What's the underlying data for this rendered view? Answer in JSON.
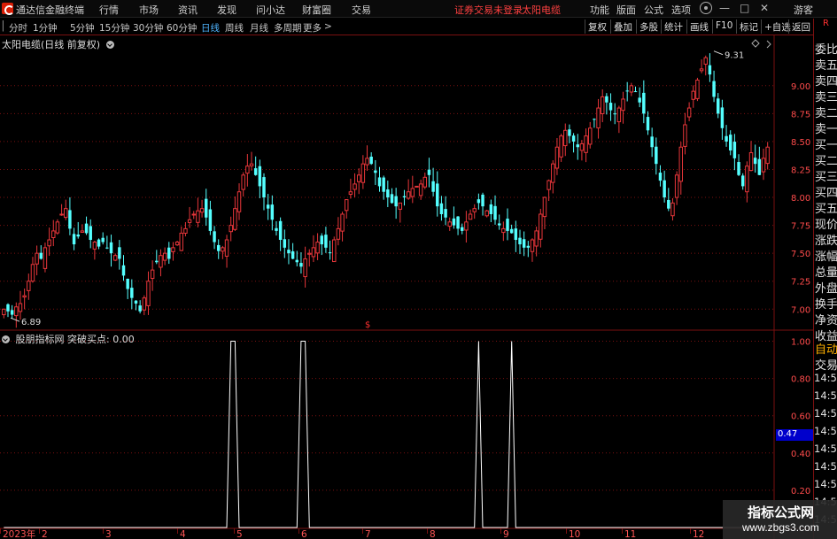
{
  "menu": {
    "app_name": "通达信金融终端",
    "items": [
      "行情",
      "市场",
      "资讯",
      "发现",
      "问小达",
      "财富圈",
      "交易"
    ],
    "notice": "证券交易未登录",
    "stock_name": "太阳电缆",
    "right_items": [
      "功能",
      "版面",
      "公式",
      "选项"
    ],
    "guest": "游客"
  },
  "periods": {
    "items": [
      "分时",
      "1分钟",
      "5分钟",
      "15分钟",
      "30分钟",
      "60分钟",
      "日线",
      "周线",
      "月线",
      "多周期",
      "更多"
    ],
    "active": "日线",
    "tools": [
      "复权",
      "叠加",
      "多股",
      "统计",
      "画线",
      "F10",
      "标记",
      "+自选",
      "返回"
    ]
  },
  "main_chart": {
    "title": "太阳电缆(日线 前复权)",
    "high_label": "9.31",
    "low_label": "6.89",
    "marker": "$"
  },
  "indicator": {
    "title": "股朋指标网 突破买点: 0.00",
    "current_value": "0.47"
  },
  "side_panel": {
    "top_label": "R",
    "labels": [
      "委比",
      "卖五",
      "卖四",
      "卖三",
      "卖二",
      "卖一",
      "买一",
      "买二",
      "买三",
      "买四",
      "买五",
      "现价",
      "涨跌",
      "涨幅",
      "总量",
      "外盘",
      "换手",
      "净资",
      "收益"
    ],
    "trade_labels": [
      "自动",
      "交易"
    ],
    "times": [
      "14:56",
      "14:56",
      "14:56",
      "14:56",
      "14:56",
      "14:56",
      "14:56",
      "14:56",
      "14:56"
    ]
  },
  "watermark": {
    "line1": "指标公式网",
    "line2": "www.zbgs3.com"
  },
  "colors": {
    "up": "#e8363a",
    "down": "#54ffff",
    "grid": "#7a1010",
    "axis_text": "#ff4b4b",
    "signal": "#ffffff",
    "active_period": "#4fb4ff"
  },
  "chart_data": [
    {
      "type": "candlestick",
      "title": "太阳电缆(日线 前复权)",
      "y_ticks": [
        7.0,
        7.25,
        7.5,
        7.75,
        8.0,
        8.25,
        8.5,
        8.75,
        9.0
      ],
      "ylim": [
        6.82,
        9.45
      ],
      "x_ticks": [
        "2023年",
        "2",
        "3",
        "4",
        "5",
        "6",
        "7",
        "8",
        "9",
        "10",
        "11",
        "12"
      ],
      "annotations": [
        {
          "text": "9.31",
          "value": 9.31
        },
        {
          "text": "6.89",
          "value": 6.89
        }
      ],
      "closes": [
        7.0,
        6.98,
        6.95,
        7.02,
        7.05,
        7.12,
        7.25,
        7.4,
        7.5,
        7.45,
        7.55,
        7.62,
        7.7,
        7.78,
        7.85,
        7.9,
        7.72,
        7.58,
        7.65,
        7.7,
        7.68,
        7.62,
        7.6,
        7.56,
        7.6,
        7.55,
        7.5,
        7.48,
        7.45,
        7.3,
        7.18,
        7.1,
        7.05,
        6.98,
        7.1,
        7.25,
        7.35,
        7.42,
        7.48,
        7.5,
        7.45,
        7.55,
        7.6,
        7.68,
        7.72,
        7.8,
        7.85,
        7.88,
        7.9,
        7.82,
        7.7,
        7.6,
        7.52,
        7.55,
        7.62,
        7.75,
        7.9,
        8.05,
        8.2,
        8.28,
        8.3,
        8.2,
        8.1,
        8.0,
        7.9,
        7.8,
        7.7,
        7.62,
        7.55,
        7.5,
        7.45,
        7.42,
        7.38,
        7.45,
        7.5,
        7.55,
        7.6,
        7.58,
        7.55,
        7.5,
        7.62,
        7.72,
        7.85,
        7.98,
        8.05,
        8.12,
        8.2,
        8.3,
        8.35,
        8.3,
        8.22,
        8.1,
        8.05,
        8.0,
        7.95,
        7.92,
        7.95,
        8.0,
        8.05,
        8.08,
        8.1,
        8.12,
        8.18,
        8.2,
        8.05,
        7.92,
        7.85,
        7.82,
        7.78,
        7.75,
        7.72,
        7.7,
        7.78,
        7.85,
        7.9,
        7.95,
        7.92,
        7.88,
        7.85,
        7.8,
        7.75,
        7.72,
        7.7,
        7.68,
        7.62,
        7.58,
        7.55,
        7.55,
        7.62,
        7.7,
        7.85,
        8.0,
        8.15,
        8.3,
        8.45,
        8.55,
        8.6,
        8.55,
        8.5,
        8.45,
        8.48,
        8.55,
        8.62,
        8.7,
        8.8,
        8.9,
        8.85,
        8.78,
        8.75,
        8.8,
        8.88,
        8.95,
        9.0,
        8.95,
        8.85,
        8.75,
        8.6,
        8.45,
        8.3,
        8.15,
        8.0,
        7.9,
        7.95,
        8.2,
        8.45,
        8.65,
        8.8,
        8.95,
        9.05,
        9.15,
        9.25,
        9.1,
        8.9,
        8.75,
        8.62,
        8.5,
        8.42,
        8.35,
        8.2,
        8.1,
        8.28,
        8.4,
        8.3,
        8.2,
        8.35,
        8.45
      ]
    },
    {
      "type": "line",
      "title": "股朋指标网 突破买点: 0.00",
      "y_ticks": [
        0.2,
        0.4,
        0.6,
        0.8,
        1.0
      ],
      "ylim": [
        0,
        1.05
      ],
      "signals_at_index": [
        55,
        56,
        72,
        73,
        115,
        123
      ]
    }
  ]
}
